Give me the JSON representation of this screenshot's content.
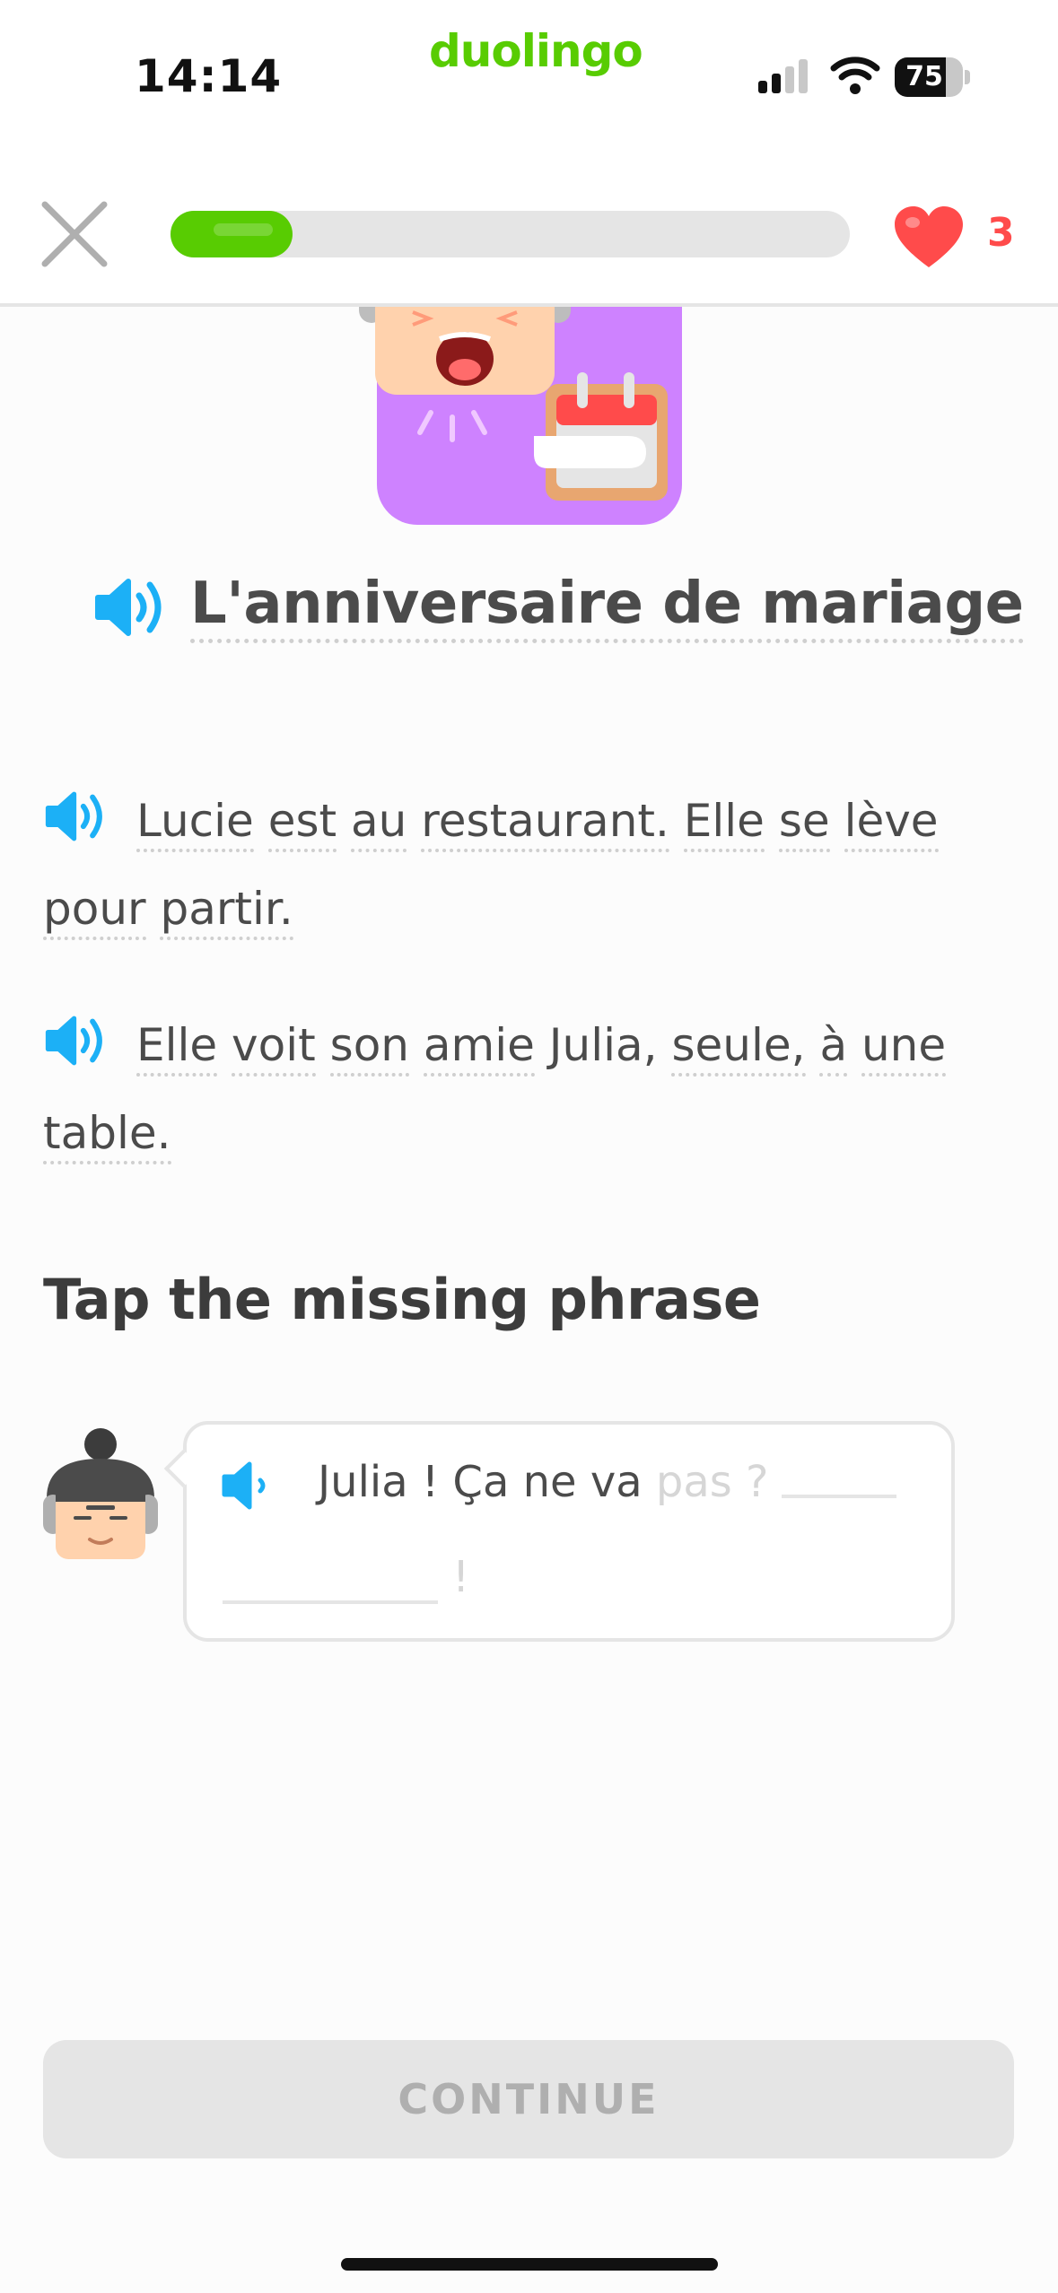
{
  "status_bar": {
    "time": "14:14",
    "brand": "duolingo",
    "battery_level": "75"
  },
  "lesson": {
    "progress_percent": 18,
    "hearts": "3"
  },
  "story": {
    "title": "L'anniversaire de mariage",
    "lines": [
      {
        "words": [
          "Lucie",
          " ",
          "est",
          " ",
          "au",
          " ",
          "restaurant.",
          " ",
          "Elle",
          " ",
          "se",
          " ",
          "lève",
          " ",
          "pour",
          " ",
          "partir."
        ]
      },
      {
        "words": [
          "Elle",
          " ",
          "voit",
          " ",
          "son",
          " ",
          "amie",
          " ",
          "Julia,",
          " ",
          "seule,",
          " ",
          "à",
          " ",
          "une",
          " ",
          "table."
        ]
      }
    ]
  },
  "exercise": {
    "instruction": "Tap the missing phrase",
    "bubble_text": "Julia ! Ça ne va",
    "bubble_faded": "pas ?",
    "bubble_end": "!"
  },
  "footer": {
    "continue_label": "CONTINUE"
  },
  "colors": {
    "green": "#58cc02",
    "red": "#ff4b4b",
    "blue": "#1cb0f6",
    "gray": "#e5e5e5"
  }
}
